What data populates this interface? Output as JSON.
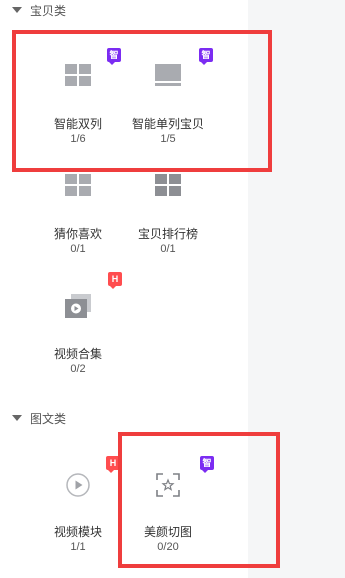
{
  "sections": [
    {
      "title": "宝贝类",
      "tiles": [
        {
          "label": "智能双列",
          "count": "1/6",
          "badge": "智",
          "icon": "double-column-icon"
        },
        {
          "label": "智能单列宝贝",
          "count": "1/5",
          "badge": "智",
          "icon": "single-column-icon"
        },
        {
          "label": "猜你喜欢",
          "count": "0/1",
          "badge": "",
          "icon": "grid-icon"
        },
        {
          "label": "宝贝排行榜",
          "count": "0/1",
          "badge": "",
          "icon": "ranking-grid-icon"
        },
        {
          "label": "视频合集",
          "count": "0/2",
          "badge": "H",
          "icon": "video-collection-icon"
        }
      ]
    },
    {
      "title": "图文类",
      "tiles": [
        {
          "label": "视频模块",
          "count": "1/1",
          "badge": "H",
          "icon": "video-play-icon"
        },
        {
          "label": "美颜切图",
          "count": "0/20",
          "badge": "智",
          "icon": "crop-focus-icon"
        }
      ]
    }
  ],
  "colors": {
    "highlight": "#ef3d3d",
    "smart_badge": "#7b2cf2",
    "hot_badge": "#ff4d4f"
  }
}
